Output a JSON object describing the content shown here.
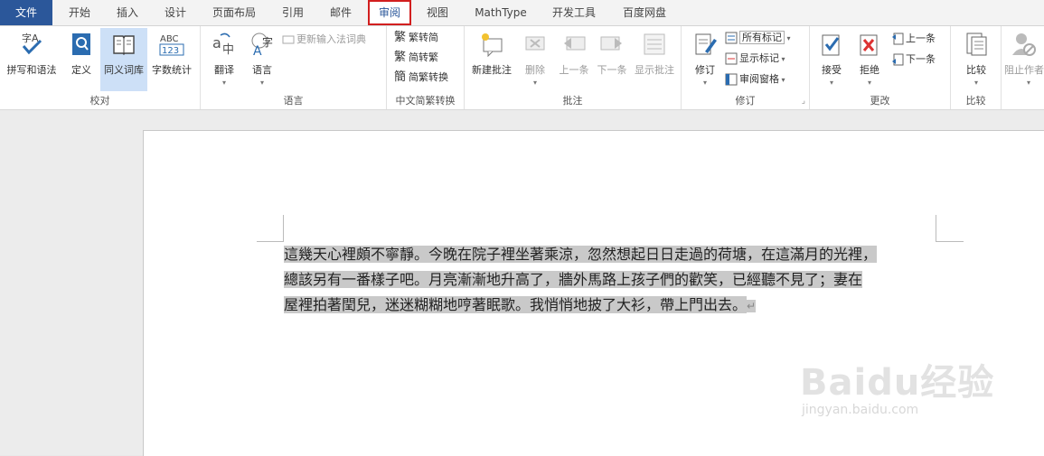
{
  "tabs": [
    {
      "label": "文件"
    },
    {
      "label": "开始"
    },
    {
      "label": "插入"
    },
    {
      "label": "设计"
    },
    {
      "label": "页面布局"
    },
    {
      "label": "引用"
    },
    {
      "label": "邮件"
    },
    {
      "label": "审阅"
    },
    {
      "label": "视图"
    },
    {
      "label": "MathType"
    },
    {
      "label": "开发工具"
    },
    {
      "label": "百度网盘"
    }
  ],
  "groups": {
    "proofing": {
      "label": "校对",
      "spelling": "拼写和语法",
      "define": "定义",
      "thesaurus": "同义词库",
      "wordcount": "字数统计"
    },
    "language": {
      "label": "语言",
      "translate": "翻译",
      "language": "语言",
      "update_ime": "更新输入法词典"
    },
    "chinese": {
      "label": "中文简繁转换",
      "trad_to_simp": "繁转简",
      "simp_to_trad": "简转繁",
      "convert": "简繁转换"
    },
    "comments": {
      "label": "批注",
      "new": "新建批注",
      "delete": "删除",
      "prev": "上一条",
      "next": "下一条",
      "show": "显示批注"
    },
    "tracking": {
      "label": "修订",
      "track": "修订",
      "markup_select": "所有标记",
      "show_markup": "显示标记",
      "reviewing_pane": "审阅窗格"
    },
    "changes": {
      "label": "更改",
      "accept": "接受",
      "reject": "拒绝",
      "prev": "上一条",
      "next": "下一条"
    },
    "compare": {
      "label": "比较",
      "compare": "比较"
    },
    "protect": {
      "block_authors": "阻止作者"
    }
  },
  "document": {
    "line1": "這幾天心裡頗不寧靜。今晚在院子裡坐著乘涼，忽然想起日日走過的荷塘，在這滿月的光裡，",
    "line2": "總該另有一番樣子吧。月亮漸漸地升高了，牆外馬路上孩子們的歡笑，已經聽不見了；妻在",
    "line3": "屋裡拍著閏兒，迷迷糊糊地哼著眠歌。我悄悄地披了大衫，帶上門出去。",
    "para_mark": "↵"
  },
  "watermark": {
    "brand": "Baidu经验",
    "url": "jingyan.baidu.com"
  },
  "colors": {
    "file_tab": "#2b579a",
    "active_border": "#d21f1f",
    "highlight": "#c9c9c9"
  }
}
